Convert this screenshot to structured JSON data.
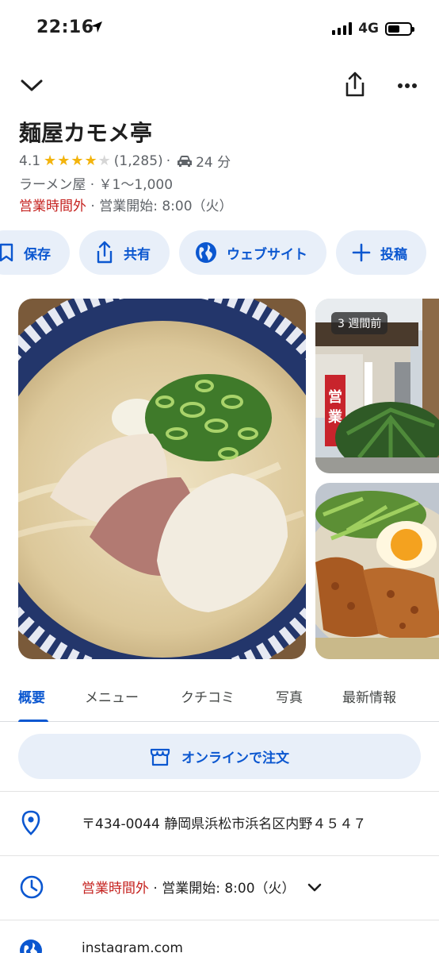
{
  "status": {
    "time": "22:16",
    "network": "4G"
  },
  "place": {
    "name": "麺屋カモメ亭",
    "rating": "4.1",
    "stars": 4,
    "reviews": "(1,285)",
    "drive_time": "24 分",
    "category": "ラーメン屋 · ￥1～1,000",
    "hours_status": "営業時間外",
    "hours_next": "· 営業開始: 8:00（火）"
  },
  "actions": [
    {
      "label": "保存",
      "icon": "bookmark-icon"
    },
    {
      "label": "共有",
      "icon": "share-icon"
    },
    {
      "label": "ウェブサイト",
      "icon": "globe-icon"
    },
    {
      "label": "投稿",
      "icon": "plus-icon"
    }
  ],
  "photos": {
    "badge": "3 週間前"
  },
  "tabs": [
    "概要",
    "メニュー",
    "クチコミ",
    "写真",
    "最新情報"
  ],
  "order": {
    "label": "オンラインで注文"
  },
  "info": {
    "address": "〒434-0044 静岡県浜松市浜名区内野４５４７",
    "hours_status": "営業時間外",
    "hours_next": "· 営業開始: 8:00（火）",
    "website": "instagram.com"
  },
  "colors": {
    "accent": "#0b57d0",
    "chip_bg": "#e8eff9",
    "closed_red": "#c5221f",
    "star": "#f3b40d"
  }
}
